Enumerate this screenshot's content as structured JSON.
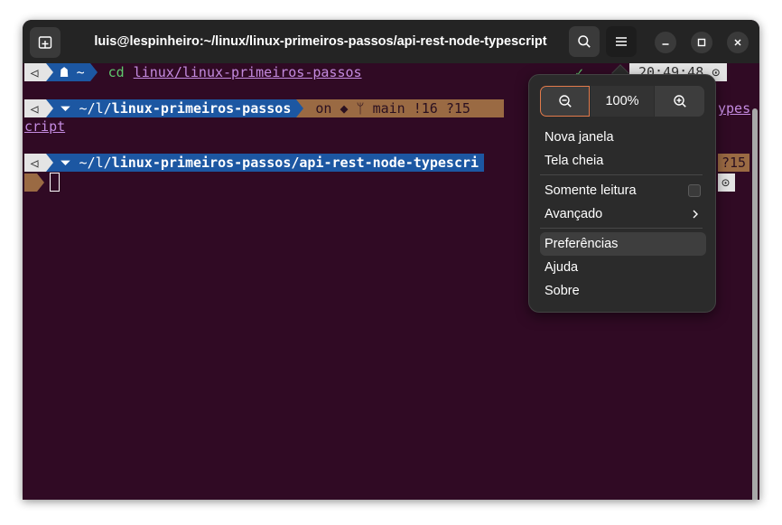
{
  "window": {
    "title": "luis@lespinheiro:~/linux/linux-primeiros-passos/api-rest-node-typescript"
  },
  "terminal": {
    "line1": {
      "os_glyph": "⏿",
      "dir": "☗ ~",
      "command": "cd",
      "argument": "linux/linux-primeiros-passos",
      "check": "✓",
      "time": "20:49:48 ⊙"
    },
    "line2": {
      "os_glyph": "⏿",
      "dir_prefix": "⏷ ~/l/",
      "dir_bold": "linux-primeiros-passos",
      "git_text": " on ◆ ᛘ main !16 ?15",
      "overflow_tail": "ypes",
      "wrap": "cript"
    },
    "line3": {
      "os_glyph": "⏿",
      "dir_prefix": "⏷ ~/l/",
      "dir_bold": "linux-primeiros-passos/api-rest-node-typescri",
      "git_tail": "?15",
      "clock_tail": "⊙"
    }
  },
  "menu": {
    "zoom_level": "100%",
    "items": [
      {
        "label": "Nova janela"
      },
      {
        "label": "Tela cheia"
      },
      {
        "label": "Somente leitura"
      },
      {
        "label": "Avançado"
      },
      {
        "label": "Preferências"
      },
      {
        "label": "Ajuda"
      },
      {
        "label": "Sobre"
      }
    ]
  },
  "colors": {
    "terminal_bg": "#300a24",
    "titlebar_bg": "#242424",
    "prompt_dir_bg": "#1c57a2",
    "prompt_git_bg": "#9a6a43",
    "accent_focus": "#e27a4b"
  }
}
